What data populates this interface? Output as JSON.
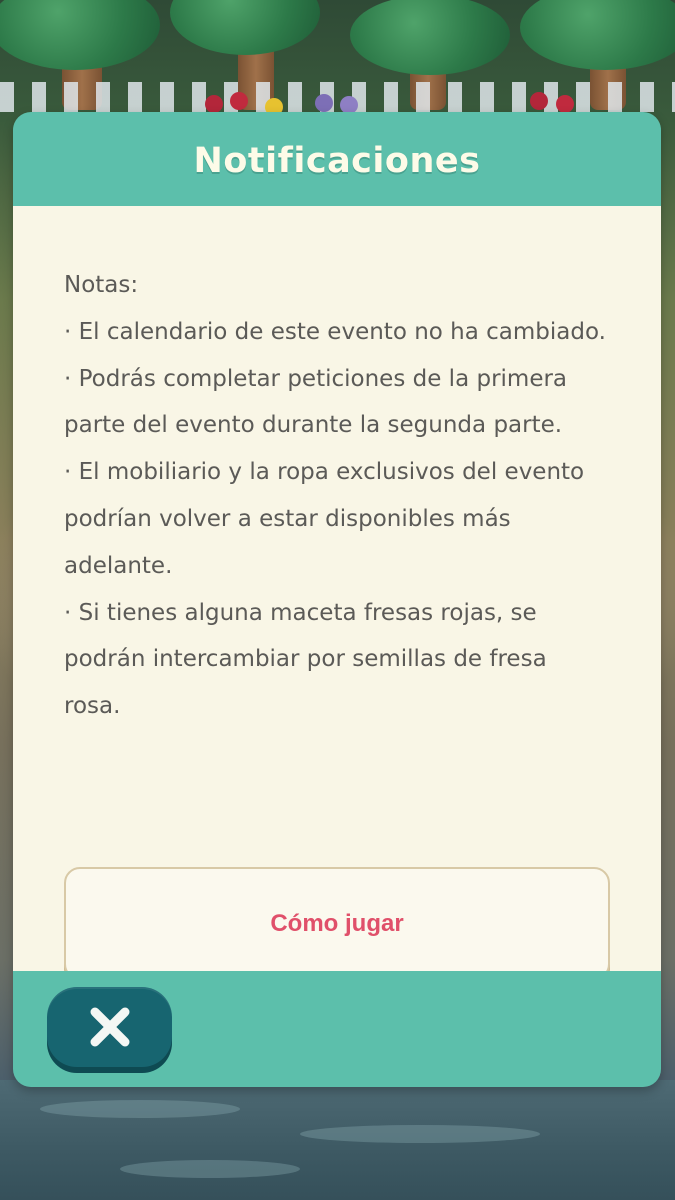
{
  "dialog": {
    "title": "Notificaciones",
    "notes_lines": [
      "Notas:",
      "· El calendario de este evento no ha cambiado.",
      "· Podrás completar peticiones de la primera",
      "parte del evento durante la segunda parte.",
      "· El mobiliario y la ropa exclusivos del evento",
      "podrían volver a estar disponibles más",
      "adelante.",
      "· Si tienes alguna maceta fresas rojas, se",
      "podrán intercambiar por semillas de fresa",
      "rosa."
    ],
    "how_to_play_label": "Cómo jugar",
    "close_icon": "close-x-icon"
  },
  "colors": {
    "header_teal": "#5cbfab",
    "body_cream": "#f9f6e6",
    "text_gray": "#5b5a57",
    "accent_pink": "#e0506a",
    "close_button": "#176570"
  }
}
